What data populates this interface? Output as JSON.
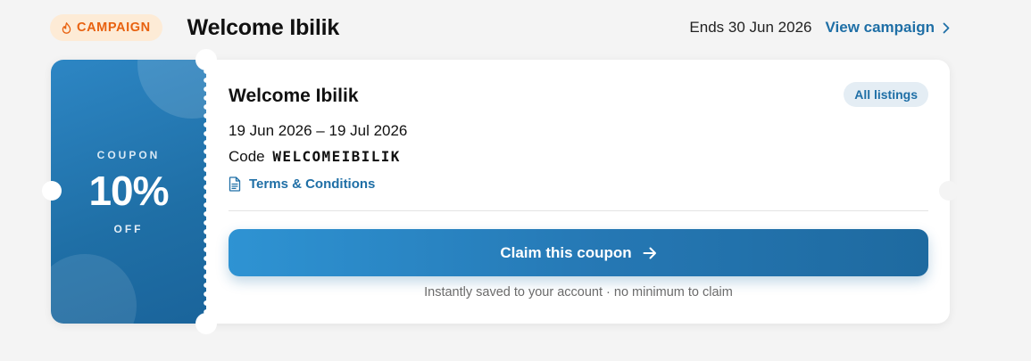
{
  "header": {
    "badge": {
      "label": "CAMPAIGN",
      "icon": "flame-icon",
      "color": "#e8610f"
    },
    "title": "Welcome Ibilik",
    "ends_text": "Ends 30 Jun 2026",
    "view_link": "View campaign"
  },
  "coupon": {
    "stub": {
      "top_label": "COUPON",
      "value": "10%",
      "bottom_label": "OFF"
    },
    "name": "Welcome Ibilik",
    "scope": "All listings",
    "dates": "19 Jun 2026 – 19 Jul 2026",
    "code_label": "Code",
    "code": "WELCOMEIBILIK",
    "terms_link": "Terms & Conditions",
    "claim_button": "Claim this coupon",
    "footnote": "Instantly saved to your account · no minimum to claim"
  },
  "colors": {
    "accent": "#1f6fa6",
    "badge_bg": "#fdebd6",
    "page_bg": "#f4f4f4"
  }
}
